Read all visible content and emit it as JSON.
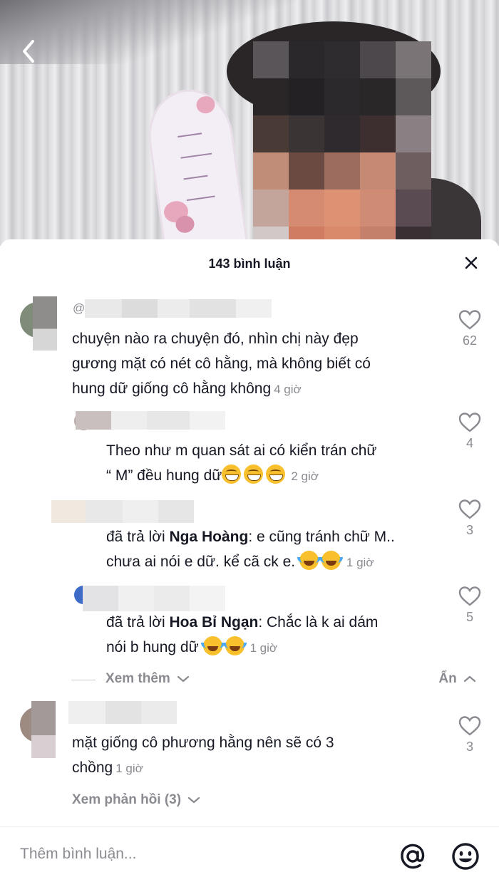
{
  "comments_header": {
    "title": "143 bình luận"
  },
  "comments": [
    {
      "text": "chuyện nào ra chuyện đó, nhìn chị này đẹp",
      "text2": "gương mặt có nét cô hằng, mà không biết có",
      "text3": "hung dữ giống cô hằng không",
      "time": "4 giờ",
      "likes": "62",
      "handle_prefix": "@"
    },
    {
      "text": "Theo như m quan sát ai có kiển trán chữ",
      "text2": "“ M” đều hung dữ",
      "time": "2 giờ",
      "likes": "4"
    },
    {
      "reply_prefix": "đã trả lời ",
      "reply_to": "Nga Hoàng",
      "text": ": e cũng tránh chữ M..",
      "text2": "chưa ai nói e dữ. kể cã ck e. ",
      "time": "1 giờ",
      "likes": "3"
    },
    {
      "reply_prefix": "đã trả lời ",
      "reply_to": "Hoa Bỉ Ngạn",
      "text": ": Chắc là k ai dám",
      "text2": "nói b hung dữ ",
      "time": "1 giờ",
      "likes": "5"
    },
    {
      "text": "mặt giống cô phương hằng nên sẽ có 3",
      "text2": "chồng",
      "time": "1 giờ",
      "likes": "3"
    }
  ],
  "thread": {
    "see_more": "Xem thêm",
    "hide": "Ẩn",
    "view_replies": "Xem phản hồi (3)"
  },
  "input": {
    "placeholder": "Thêm bình luận..."
  },
  "icons": {
    "back": "chevron-left-icon",
    "close": "close-icon",
    "like": "heart-outline-icon",
    "mention": "at-sign-icon",
    "emoji": "smiley-icon"
  }
}
